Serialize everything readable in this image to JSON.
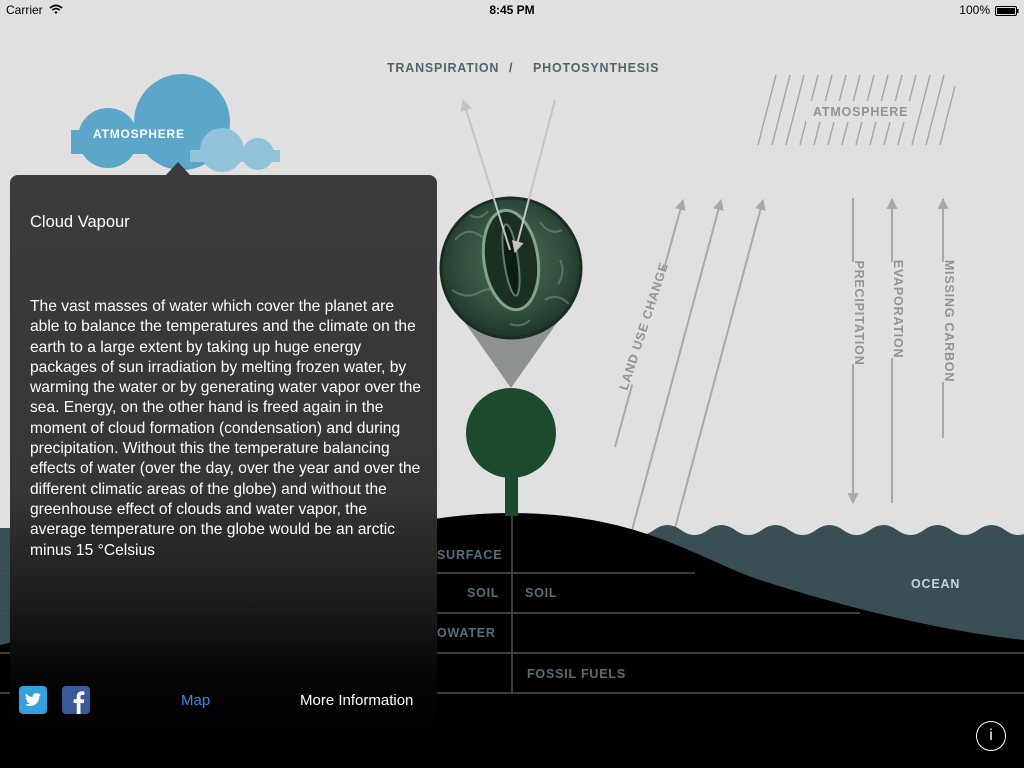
{
  "status_bar": {
    "carrier": "Carrier",
    "time": "8:45 PM",
    "battery": "100%",
    "wifi_icon": "wifi-icon",
    "battery_icon": "battery-icon"
  },
  "diagram": {
    "cloud_label": "ATMOSPHERE",
    "transpiration": "TRANSPIRATION",
    "separator": "/",
    "photosynthesis": "PHOTOSYNTHESIS",
    "atmosphere_label": "ATMOSPHERE",
    "land_use_change": "LAND USE CHANGE",
    "precipitation": "PRECIPITATION",
    "evaporation": "EVAPORATION",
    "missing_carbon": "MISSING CARBON",
    "surface": "SURFACE",
    "soil_left": "SOIL",
    "soil_right": "SOIL",
    "groundwater": "OWATER",
    "fossil_fuels": "FOSSIL FUELS",
    "ocean": "OCEAN"
  },
  "popover": {
    "title": "Cloud Vapour",
    "body": "The vast masses of water which cover the planet are able to balance the temperatures and the climate on the earth to a large extent by taking up huge energy packages of sun irradiation by melting frozen water, by warming the water or by generating water vapor over the sea. Energy, on the other hand is freed again in the moment of cloud formation (condensation) and during precipitation. Without this the temperature balancing effects of water (over the day, over the year and over the different climatic areas of the globe) and without the greenhouse effect of clouds and water vapor, the average temperature on the globe would be an arctic minus 15 °Celsius",
    "share_icons": [
      "twitter-icon",
      "facebook-icon"
    ],
    "map_link": "Map",
    "more_info": "More Information"
  },
  "info_button": {
    "label": "i",
    "icon": "info-icon"
  },
  "colors": {
    "background": "#e0e0e0",
    "cloud": "#5ba6c9",
    "cloud_light": "#93c3da",
    "ocean": "#3a4e56",
    "tree": "#1d4a2d",
    "popover": "#3c3c3c",
    "link": "#3a86e6"
  }
}
